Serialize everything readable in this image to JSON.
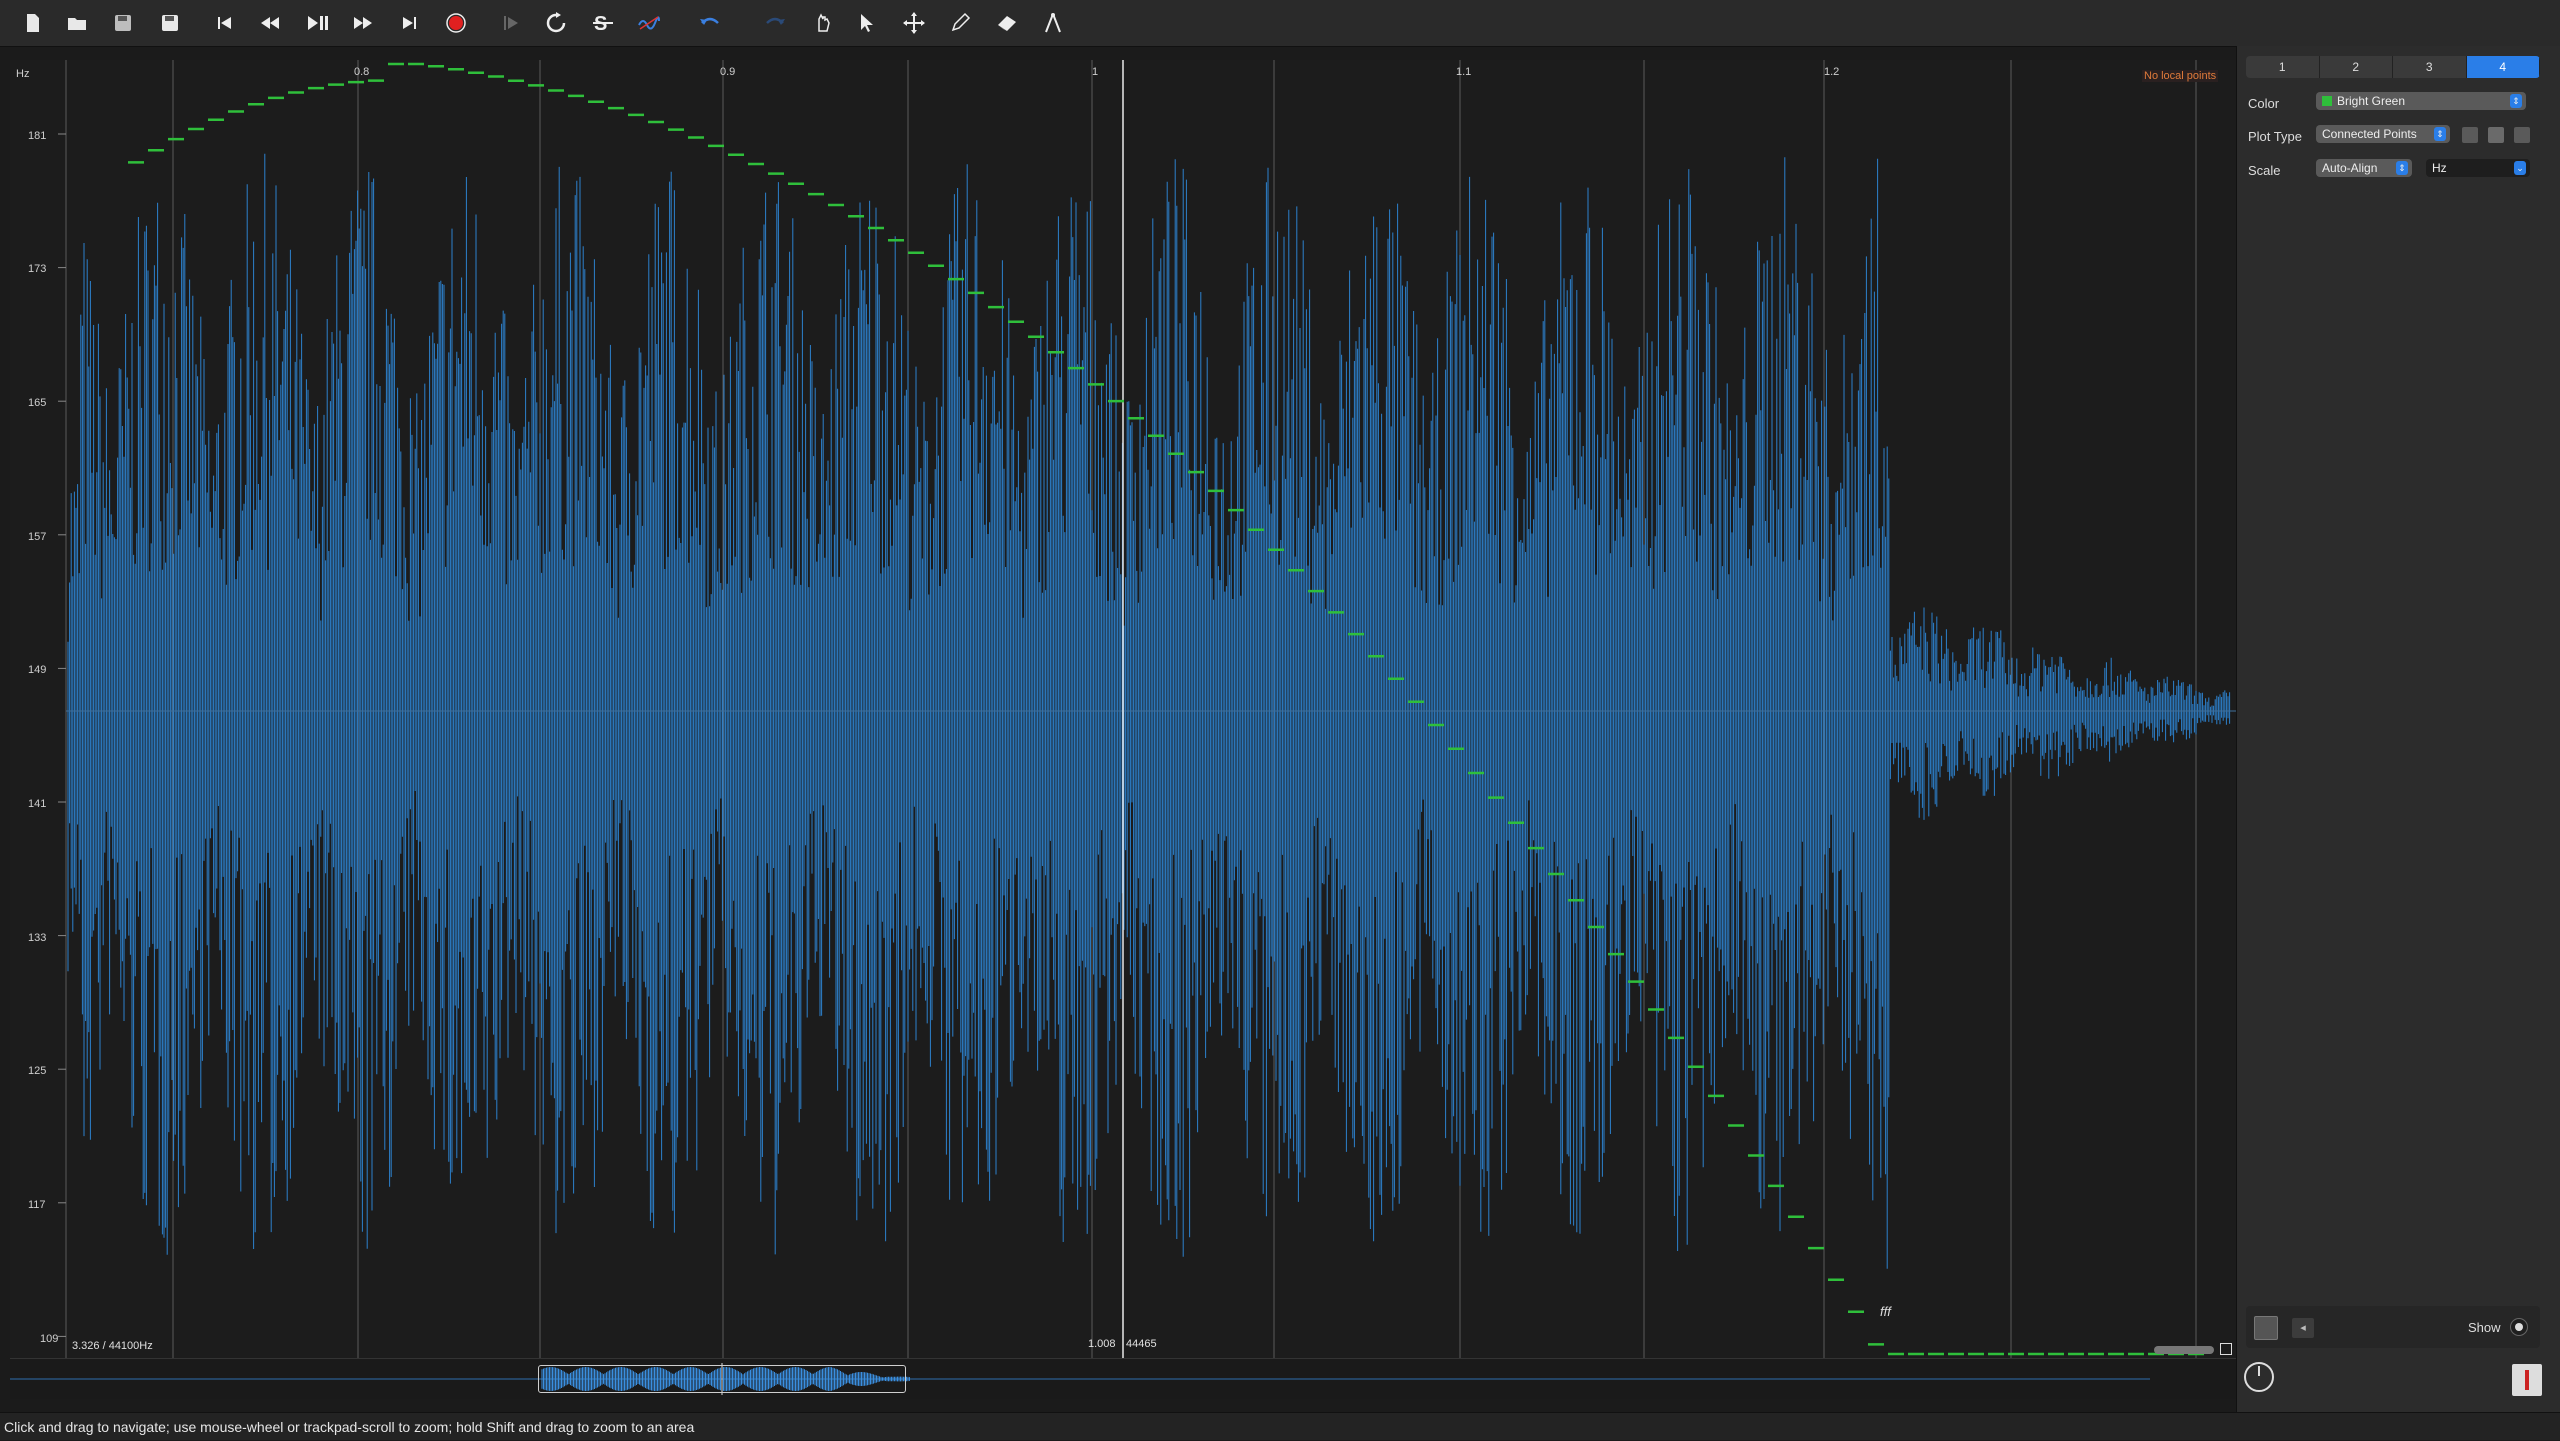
{
  "toolbar": {
    "buttons": [
      "new-file",
      "open-file",
      "save",
      "save-as",
      "skip-to-start",
      "rewind",
      "play-pause",
      "fast-forward",
      "skip-to-end",
      "record",
      "play-selection",
      "loop",
      "solo",
      "normalize",
      "undo",
      "redo",
      "navigate-tool",
      "select-tool",
      "move-tool",
      "draw-tool",
      "erase-tool",
      "measure-tool"
    ]
  },
  "view": {
    "y_unit": "Hz",
    "y_ticks": [
      "181",
      "173",
      "165",
      "157",
      "149",
      "141",
      "133",
      "125",
      "117",
      "109"
    ],
    "x_ticks": [
      "0.8",
      "0.9",
      "1",
      "1.1",
      "1.2"
    ],
    "no_points_label": "No local points",
    "left_readout": "3.326 / 44100Hz",
    "cursor_time": "1.008",
    "cursor_sample": "44465",
    "note_label": "fff"
  },
  "colors": {
    "waveform": "#2d86d6",
    "pitch_curve": "#2fbf3b",
    "accent": "#2a7ee8",
    "warning": "#e07a3a"
  },
  "panel": {
    "tabs": [
      "1",
      "2",
      "3",
      "4"
    ],
    "active_tab": "4",
    "color_label": "Color",
    "color_value": "Bright Green",
    "plot_type_label": "Plot Type",
    "plot_type_value": "Connected Points",
    "scale_label": "Scale",
    "scale_value": "Auto-Align",
    "scale_unit": "Hz",
    "show_label": "Show"
  },
  "status": {
    "text": "Click and drag to navigate; use mouse-wheel or trackpad-scroll to zoom; hold Shift and drag to zoom to an area"
  }
}
